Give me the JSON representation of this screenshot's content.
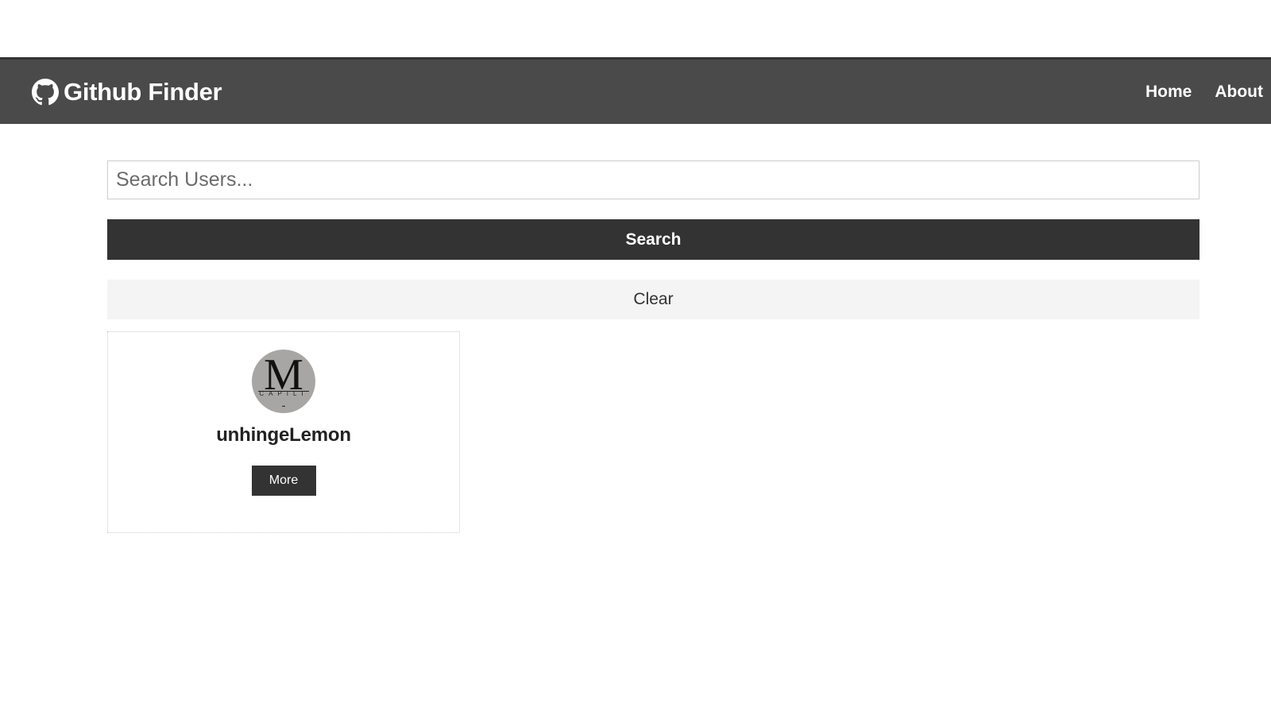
{
  "navbar": {
    "brand_icon": "github-icon",
    "title": "Github Finder",
    "links": [
      {
        "label": "Home"
      },
      {
        "label": "About"
      }
    ],
    "background": "#4a4a4a"
  },
  "search": {
    "placeholder": "Search Users...",
    "value": "",
    "search_label": "Search",
    "clear_label": "Clear"
  },
  "users": [
    {
      "username": "unhingeLemon",
      "avatar": {
        "letter": "M",
        "subtext": "CAPILI"
      },
      "more_label": "More"
    }
  ],
  "colors": {
    "dark": "#333333",
    "light": "#f4f4f4",
    "navbar": "#4a4a4a"
  }
}
